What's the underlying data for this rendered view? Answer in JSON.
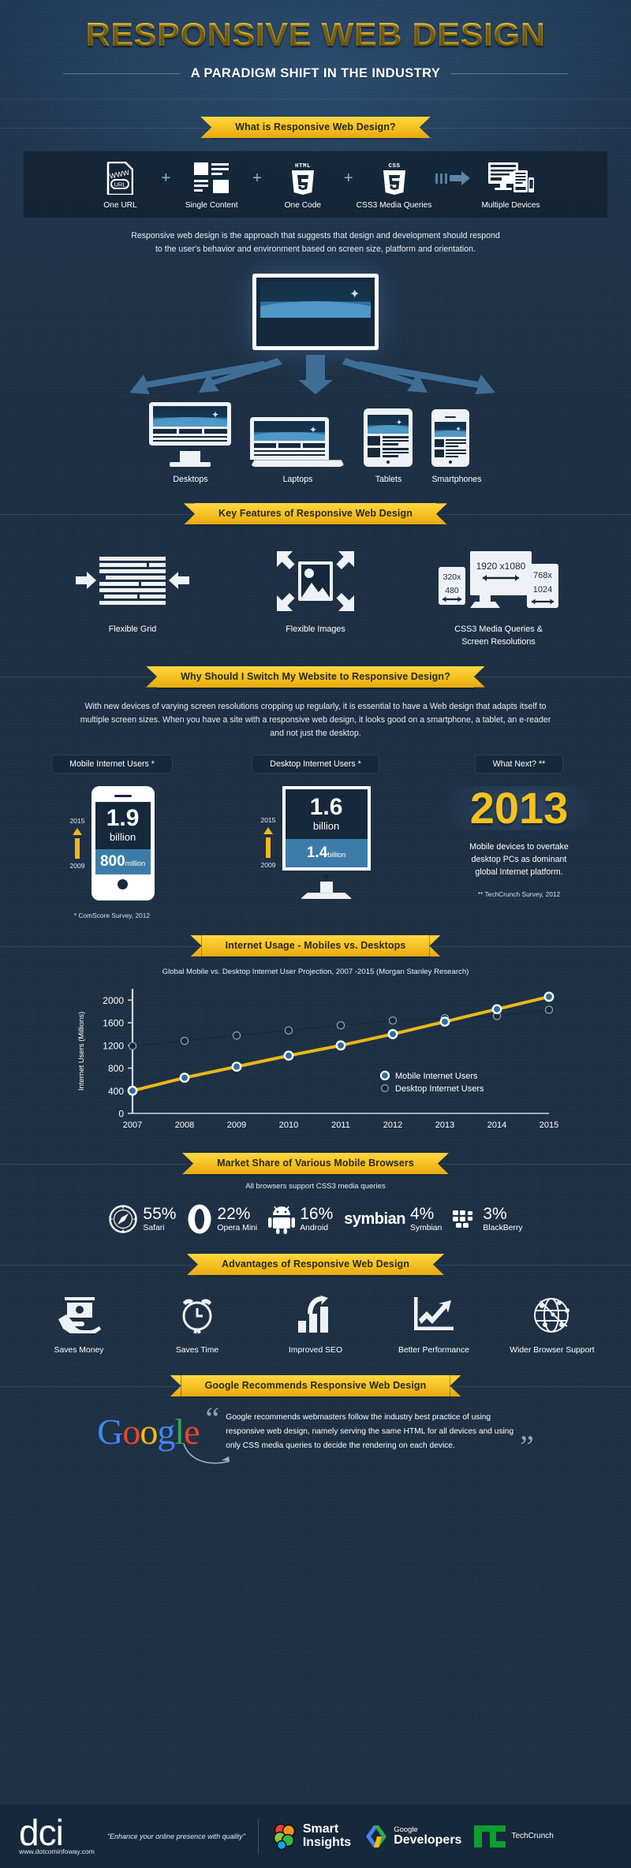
{
  "header": {
    "title": "RESPONSIVE WEB DESIGN",
    "subtitle": "A PARADIGM SHIFT IN THE INDUSTRY"
  },
  "colors": {
    "accent_yellow": "#f3c220",
    "background_dark": "#1c2f42",
    "panel_dark": "#16283b",
    "mobile_line": "#e8b919",
    "desktop_line": "#16283b",
    "device_light": "#eef2f6"
  },
  "section_what": {
    "ribbon": "What  is Responsive Web Design?",
    "formula": [
      {
        "label": "One URL",
        "icon": "one-url-icon"
      },
      {
        "label": "Single Content",
        "icon": "single-content-icon"
      },
      {
        "label": "One Code",
        "icon": "html5-icon"
      },
      {
        "label": "CSS3 Media Queries",
        "icon": "css3-icon"
      },
      {
        "label": "Multiple Devices",
        "icon": "multiple-devices-icon"
      }
    ],
    "separators": [
      "+",
      "+",
      "+"
    ],
    "arrow": "➤",
    "paragraph_line1": "Responsive web design is the approach that suggests that design and development should respond",
    "paragraph_line2": "to the user's behavior and environment based on screen size,  platform and orientation."
  },
  "section_devices": {
    "devices": [
      {
        "label": "Desktops",
        "icon": "desktop-icon"
      },
      {
        "label": "Laptops",
        "icon": "laptop-icon"
      },
      {
        "label": "Tablets",
        "icon": "tablet-icon"
      },
      {
        "label": "Smartphones",
        "icon": "smartphone-icon"
      }
    ]
  },
  "section_key_features": {
    "ribbon": "Key Features of Responsive Web Design",
    "items": [
      {
        "label": "Flexible Grid",
        "icon": "flexible-grid-icon"
      },
      {
        "label": "Flexible Images",
        "icon": "flexible-images-icon"
      },
      {
        "label_line1": "CSS3 Media Queries  &",
        "label_line2": "Screen Resolutions",
        "icon": "media-queries-icon",
        "resolutions": {
          "desktop": "1920 x1080",
          "mobile_w": "320x",
          "mobile_h": "480",
          "tablet_w": "768x",
          "tablet_h": "1024"
        }
      }
    ]
  },
  "section_why": {
    "ribbon": "Why Should I Switch My Website to Responsive Design?",
    "paragraph_line1": "With new devices of varying screen resolutions cropping up regularly, it is essential to have a Web design that adapts itself to",
    "paragraph_line2": "multiple screen sizes. When you have a site with a responsive web design, it looks good on a smartphone, a tablet, an e-reader",
    "paragraph_line3": "and not just the desktop."
  },
  "section_stats": {
    "mobile": {
      "pill": "Mobile Internet Users *",
      "year_top": "2015",
      "year_bottom": "2009",
      "value_top": "1.9",
      "unit_top": "billion",
      "value_bottom": "800",
      "unit_bottom": "million",
      "footnote": "* ComScore Survey, 2012"
    },
    "desktop": {
      "pill": "Desktop Internet Users *",
      "year_top": "2015",
      "year_bottom": "2009",
      "value_top": "1.6",
      "unit_top": "billion",
      "value_bottom": "1.4",
      "unit_bottom": "billion"
    },
    "next": {
      "pill": "What Next? **",
      "year": "2013",
      "text_line1": "Mobile devices to overtake",
      "text_line2": "desktop PCs as dominant",
      "text_line3": "global Internet platform.",
      "footnote": "** TechCrunch Survey, 2012"
    }
  },
  "section_chart": {
    "ribbon": "Internet Usage - Mobiles vs. Desktops"
  },
  "chart_data": {
    "type": "line",
    "title": "Global Mobile vs. Desktop Internet User Projection, 2007 -2015  (Morgan Stanley Research)",
    "xlabel": "",
    "ylabel": "Internet Users (Millions)",
    "x": [
      "2007",
      "2008",
      "2009",
      "2010",
      "2011",
      "2012",
      "2013",
      "2014",
      "2015"
    ],
    "ylim": [
      0,
      2200
    ],
    "yticks": [
      0,
      400,
      800,
      1200,
      1600,
      2000
    ],
    "grid": false,
    "legend_position": "inside-right",
    "series": [
      {
        "name": "Mobile Internet Users",
        "color": "#e8b919",
        "marker": "open-circle",
        "values": [
          400,
          630,
          825,
          1020,
          1200,
          1400,
          1620,
          1840,
          2060
        ]
      },
      {
        "name": "Desktop Internet Users",
        "color": "#16283b",
        "marker": "filled-circle",
        "values": [
          1190,
          1280,
          1375,
          1465,
          1555,
          1640,
          1680,
          1720,
          1830
        ]
      }
    ]
  },
  "section_browsers": {
    "ribbon": "Market Share of Various Mobile Browsers",
    "note": "All browsers support CSS3 media queries",
    "items": [
      {
        "percent": "55%",
        "name": "Safari",
        "icon": "safari-icon"
      },
      {
        "percent": "22%",
        "name": "Opera Mini",
        "icon": "opera-icon"
      },
      {
        "percent": "16%",
        "name": "Android",
        "icon": "android-icon"
      },
      {
        "percent": "4%",
        "name": "Symbian",
        "icon": "symbian-icon",
        "wordmark": "symbian"
      },
      {
        "percent": "3%",
        "name": "BlackBerry",
        "icon": "blackberry-icon"
      }
    ]
  },
  "section_advantages": {
    "ribbon": "Advantages of  Responsive Web Design",
    "items": [
      {
        "label": "Saves Money",
        "icon": "money-hand-icon"
      },
      {
        "label": "Saves Time",
        "icon": "alarm-clock-icon"
      },
      {
        "label": "Improved SEO",
        "icon": "seo-bars-icon"
      },
      {
        "label": "Better Performance",
        "icon": "growth-arrow-icon"
      },
      {
        "label": "Wider Browser Support",
        "icon": "globe-network-icon"
      }
    ]
  },
  "section_google": {
    "ribbon": "Google Recommends Responsive Web Design",
    "logo_letters": [
      {
        "ch": "G",
        "color": "#4285F4"
      },
      {
        "ch": "o",
        "color": "#EA4335"
      },
      {
        "ch": "o",
        "color": "#FBBC05"
      },
      {
        "ch": "g",
        "color": "#4285F4"
      },
      {
        "ch": "l",
        "color": "#34A853"
      },
      {
        "ch": "e",
        "color": "#EA4335"
      }
    ],
    "quote_line1": "Google recommends webmasters follow the industry best practice of using",
    "quote_line2": "responsive web design, namely serving the same HTML for all devices and using",
    "quote_line3": "only CSS media queries to decide the rendering on each device.",
    "quote_open": "“",
    "quote_close": "”"
  },
  "footer": {
    "brand": "dci",
    "url": "www.dotcominfoway.com",
    "tagline": "\"Enhance your online presence with quality\"",
    "partners": [
      {
        "line1": "Smart",
        "line2": "Insights"
      },
      {
        "line1": "Google",
        "line2": "Developers"
      },
      {
        "name": "TechCrunch",
        "prefix": "Tech",
        "suffix": "Crunch"
      }
    ]
  }
}
